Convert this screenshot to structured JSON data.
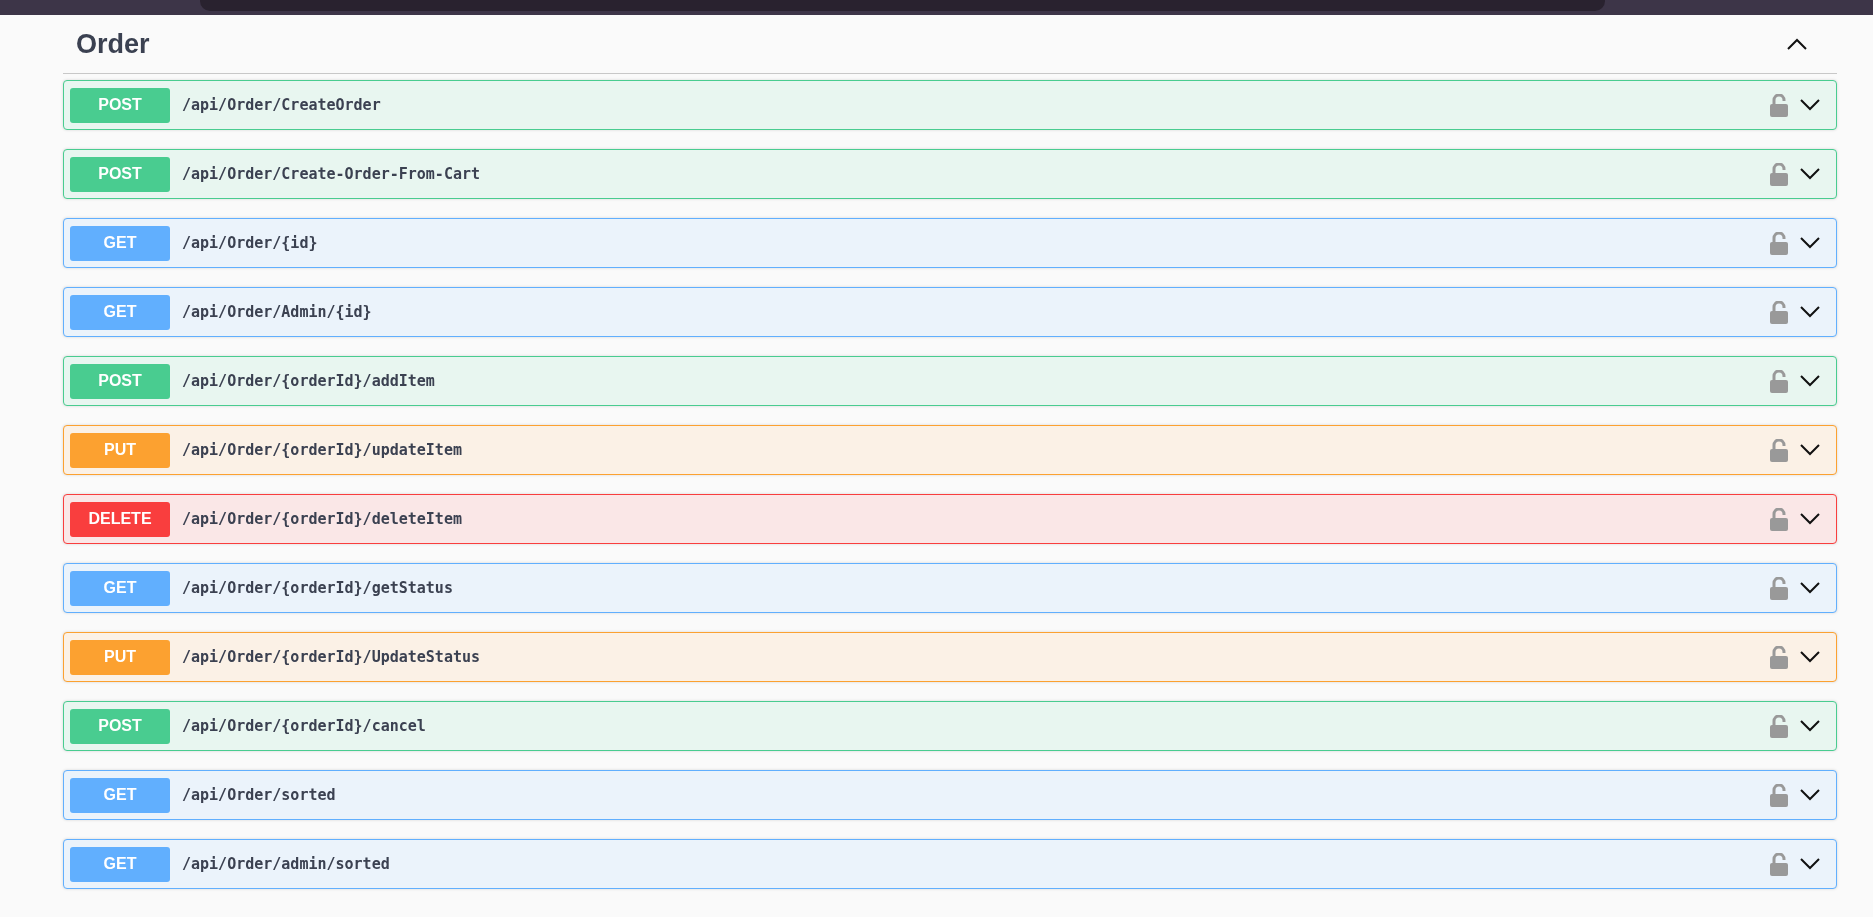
{
  "section": {
    "title": "Order",
    "expanded": true
  },
  "operations": [
    {
      "method": "POST",
      "kind": "post",
      "path": "/api/Order/CreateOrder",
      "expanded": false
    },
    {
      "method": "POST",
      "kind": "post",
      "path": "/api/Order/Create-Order-From-Cart",
      "expanded": false
    },
    {
      "method": "GET",
      "kind": "get",
      "path": "/api/Order/{id}",
      "expanded": false
    },
    {
      "method": "GET",
      "kind": "get",
      "path": "/api/Order/Admin/{id}",
      "expanded": false
    },
    {
      "method": "POST",
      "kind": "post",
      "path": "/api/Order/{orderId}/addItem",
      "expanded": false
    },
    {
      "method": "PUT",
      "kind": "put",
      "path": "/api/Order/{orderId}/updateItem",
      "expanded": false
    },
    {
      "method": "DELETE",
      "kind": "delete",
      "path": "/api/Order/{orderId}/deleteItem",
      "expanded": false
    },
    {
      "method": "GET",
      "kind": "get",
      "path": "/api/Order/{orderId}/getStatus",
      "expanded": false
    },
    {
      "method": "PUT",
      "kind": "put",
      "path": "/api/Order/{orderId}/UpdateStatus",
      "expanded": false
    },
    {
      "method": "POST",
      "kind": "post",
      "path": "/api/Order/{orderId}/cancel",
      "expanded": false
    },
    {
      "method": "GET",
      "kind": "get",
      "path": "/api/Order/sorted",
      "expanded": false
    },
    {
      "method": "GET",
      "kind": "get",
      "path": "/api/Order/admin/sorted",
      "expanded": false
    }
  ]
}
